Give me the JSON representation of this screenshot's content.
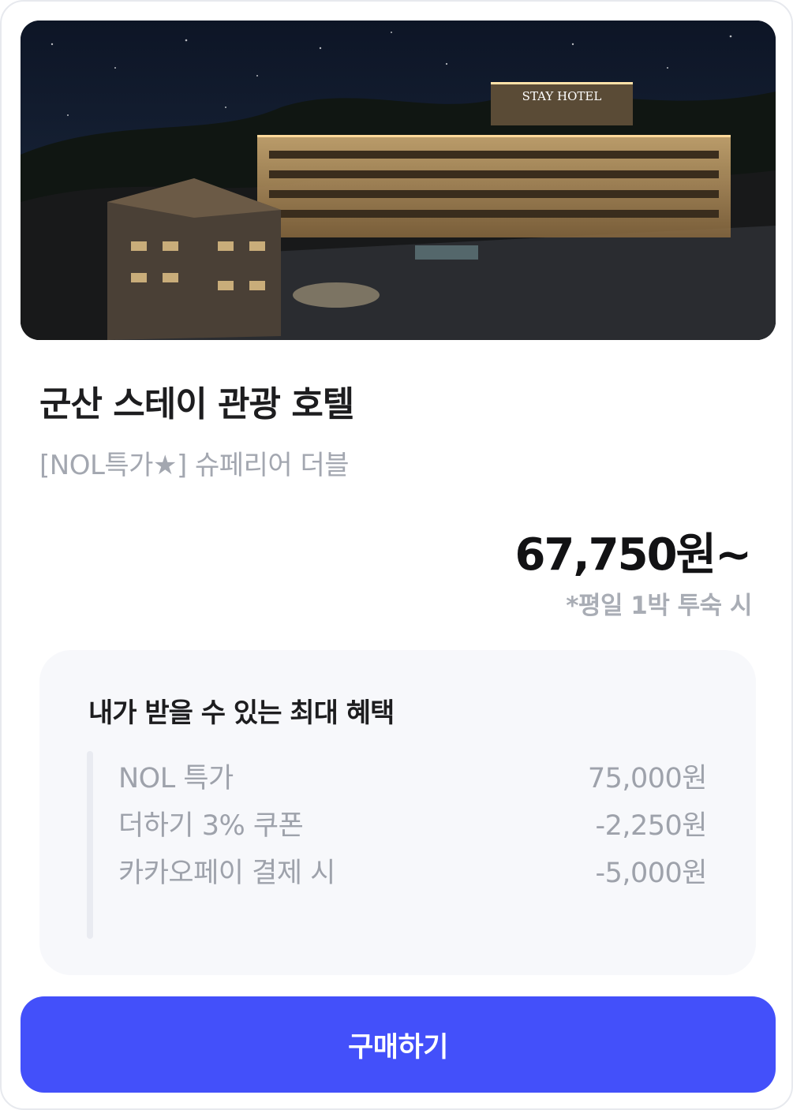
{
  "hotel": {
    "name": "군산 스테이 관광 호텔",
    "room": "[NOL특가★] 슈페리어 더블",
    "photo_icon": "hotel-photo",
    "sign_text": "STAY HOTEL"
  },
  "pricing": {
    "price": "67,750원~",
    "note": "*평일 1박 투숙 시"
  },
  "benefits": {
    "title": "내가 받을 수 있는 최대 혜택",
    "items": [
      {
        "label": "NOL 특가",
        "value": "75,000원"
      },
      {
        "label": "더하기 3% 쿠폰",
        "value": "-2,250원"
      },
      {
        "label": "카카오페이 결제 시",
        "value": "-5,000원"
      }
    ]
  },
  "actions": {
    "buy_label": "구매하기"
  },
  "colors": {
    "accent": "#4350fa",
    "muted_text": "#a3a7b0",
    "benefit_bg": "#f7f8fb"
  }
}
